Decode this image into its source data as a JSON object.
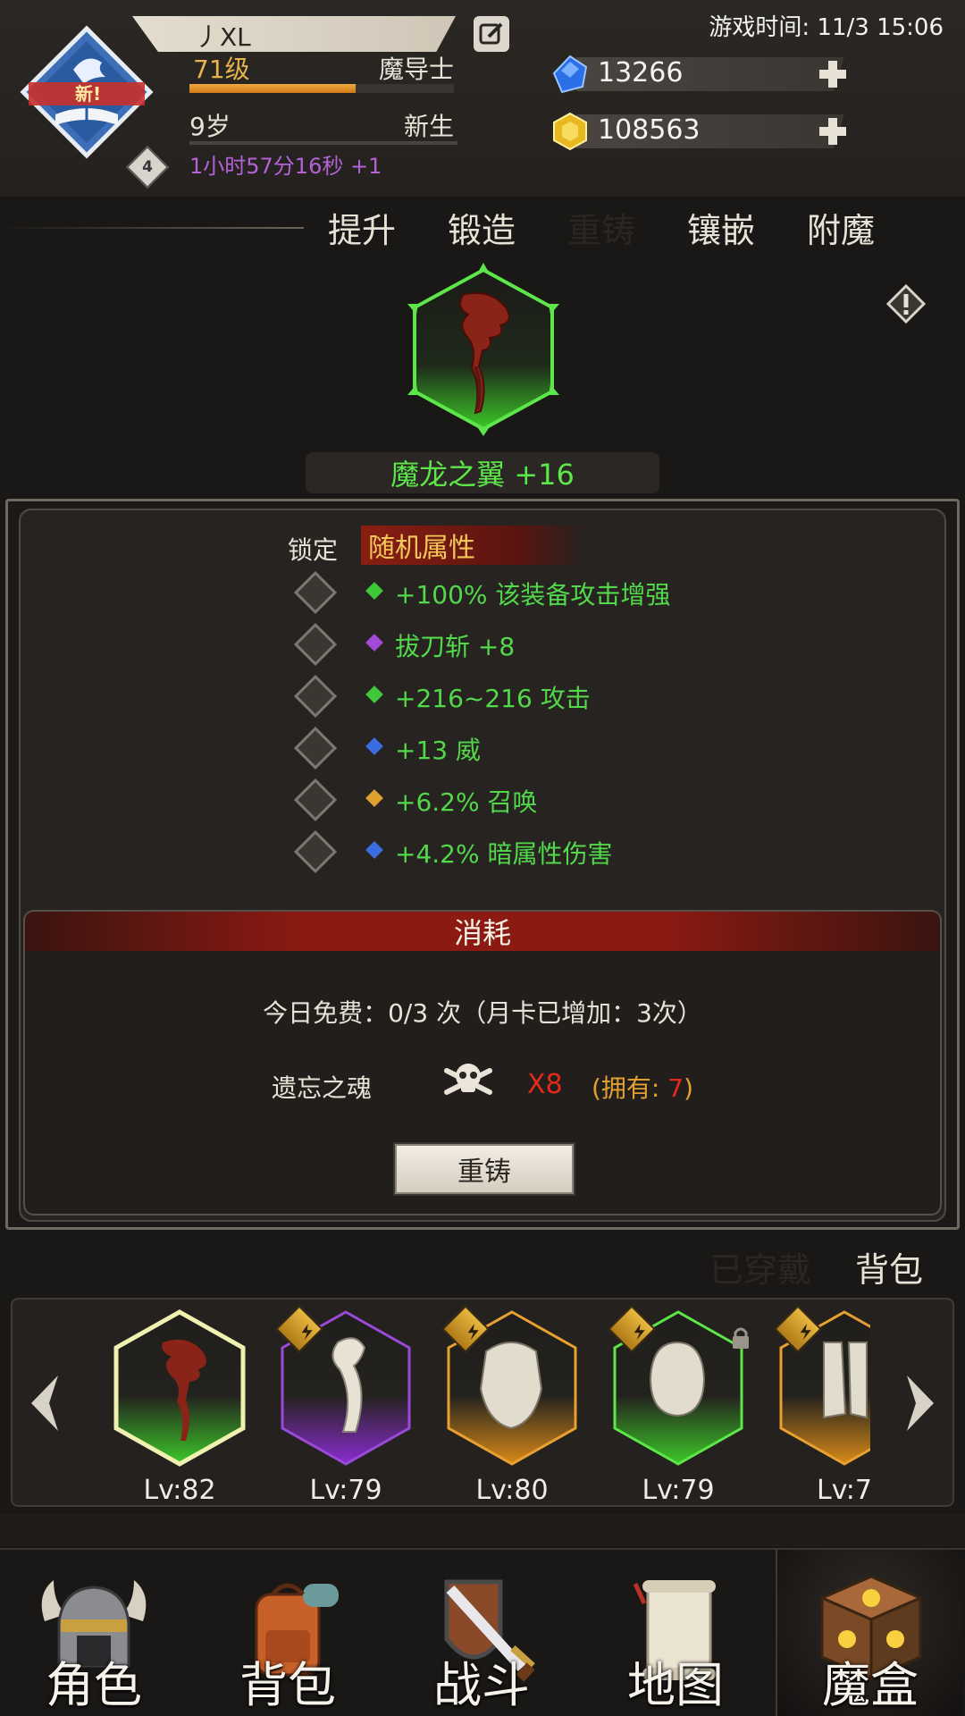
{
  "header": {
    "player_name": "丿XL",
    "level": "71级",
    "class": "魔导士",
    "xp_fraction": 0.63,
    "age": "9岁",
    "status": "新生",
    "timer": "1小时57分16秒 +1",
    "emblem_badge": "新!",
    "emblem_level": "4",
    "game_time": "游戏时间: 11/3 15:06",
    "gems": "13266",
    "gold": "108563"
  },
  "tabs": [
    "提升",
    "锻造",
    "重铸",
    "镶嵌",
    "附魔"
  ],
  "active_tab": 2,
  "item": {
    "name": "魔龙之翼 +16"
  },
  "attributes": {
    "lock_label": "锁定",
    "random_label": "随机属性",
    "rows": [
      {
        "text": "+100% 该装备攻击增强",
        "gem": "#3ec83a"
      },
      {
        "text": "拔刀斩 +8",
        "gem": "#a24ad8"
      },
      {
        "text": "+216~216 攻击",
        "gem": "#3ec83a"
      },
      {
        "text": "+13 威",
        "gem": "#3a6ee0"
      },
      {
        "text": "+6.2% 召唤",
        "gem": "#e0a030"
      },
      {
        "text": "+4.2% 暗属性伤害",
        "gem": "#3a6ee0"
      }
    ]
  },
  "cost": {
    "title": "消耗",
    "free_text": "今日免费：0/3 次（月卡已增加：3次）",
    "material_name": "遗忘之魂",
    "material_count": "X8",
    "owned_prefix": "(拥有: ",
    "owned_value": "7",
    "owned_suffix": ")",
    "button": "重铸"
  },
  "equip_tabs": [
    "已穿戴",
    "背包"
  ],
  "equip_slots": [
    {
      "lv": "Lv:82",
      "rarity": "green"
    },
    {
      "lv": "Lv:79",
      "rarity": "purple"
    },
    {
      "lv": "Lv:80",
      "rarity": "orange"
    },
    {
      "lv": "Lv:79",
      "rarity": "green"
    },
    {
      "lv": "Lv:7",
      "rarity": "orange"
    }
  ],
  "nav": [
    "角色",
    "背包",
    "战斗",
    "地图",
    "魔盒"
  ],
  "colors": {
    "accent_green": "#5ce64a",
    "accent_red": "#8a1a12",
    "gold_text": "#e6b44a"
  }
}
